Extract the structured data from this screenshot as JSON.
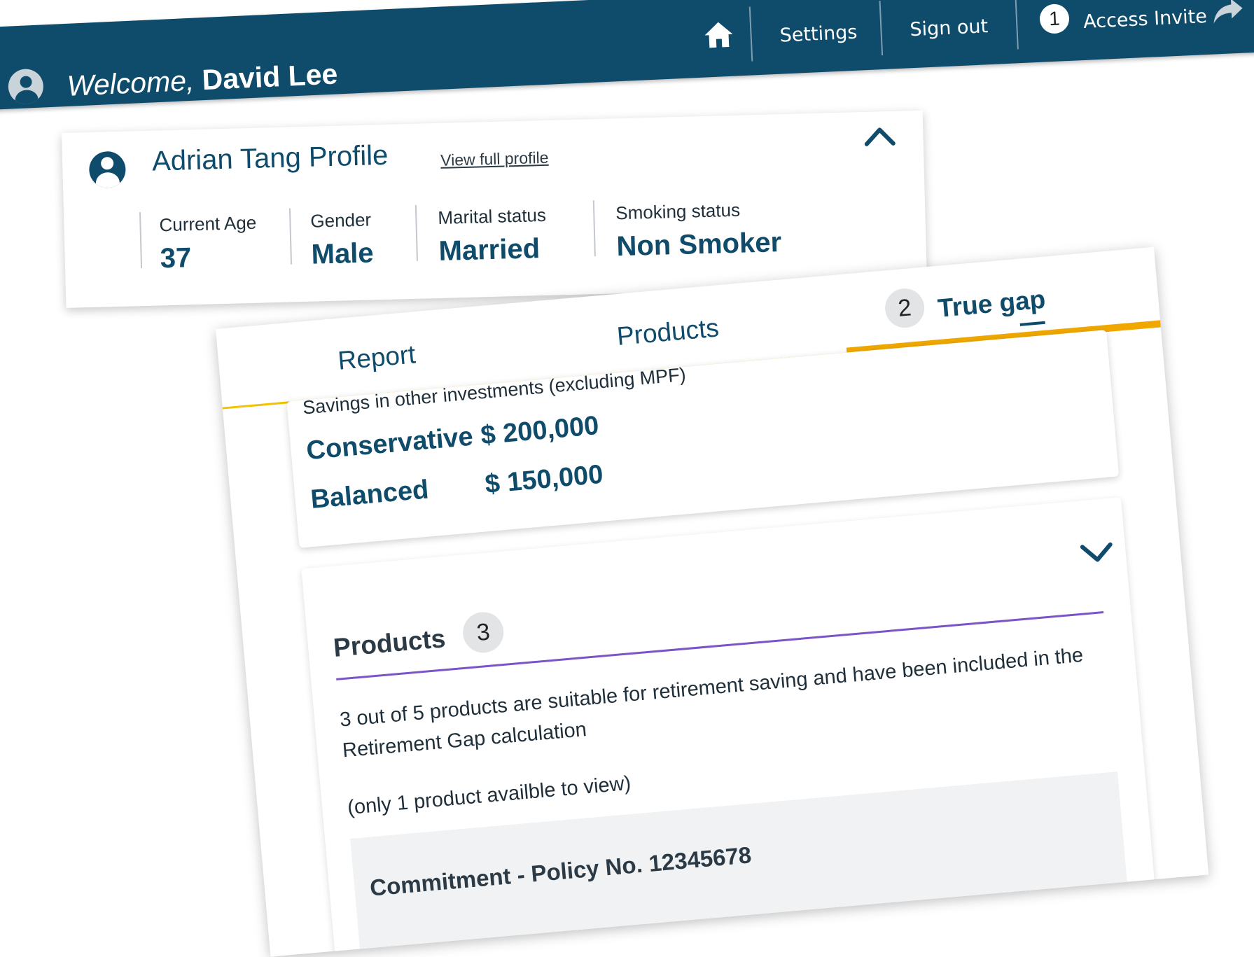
{
  "header": {
    "welcome_prefix": "Welcome,",
    "user_name": "David Lee",
    "nav": {
      "home_icon": "home-icon",
      "settings": "Settings",
      "sign_out": "Sign out",
      "access_invite_badge": "1",
      "access_invite": "Access Invite",
      "share_icon": "share-icon"
    },
    "colors": {
      "bar": "#0f4b6a",
      "accent": "#f0a800",
      "divider": "#7b55c8"
    }
  },
  "profile": {
    "title": "Adrian Tang Profile",
    "view_full_link": "View full profile",
    "stats": [
      {
        "label": "Current Age",
        "value": "37"
      },
      {
        "label": "Gender",
        "value": "Male"
      },
      {
        "label": "Marital status",
        "value": "Married"
      },
      {
        "label": "Smoking status",
        "value": "Non Smoker"
      }
    ]
  },
  "tabs": [
    {
      "label": "Report"
    },
    {
      "label": "Products"
    },
    {
      "label": "True gap",
      "badge": "2",
      "active": true
    }
  ],
  "investments": {
    "heading": "Savings in other investments (excluding MPF)",
    "rows": [
      {
        "name": "Conservative",
        "amount": "$ 200,000"
      },
      {
        "name": "Balanced",
        "amount": "$ 150,000"
      }
    ]
  },
  "products_section": {
    "title": "Products",
    "badge": "3",
    "description": "3 out of 5 products are suitable for retirement saving and have been included in the Retirement Gap calculation",
    "note": "(only 1 product availble to view)",
    "policy": "Commitment - Policy No. 12345678"
  }
}
